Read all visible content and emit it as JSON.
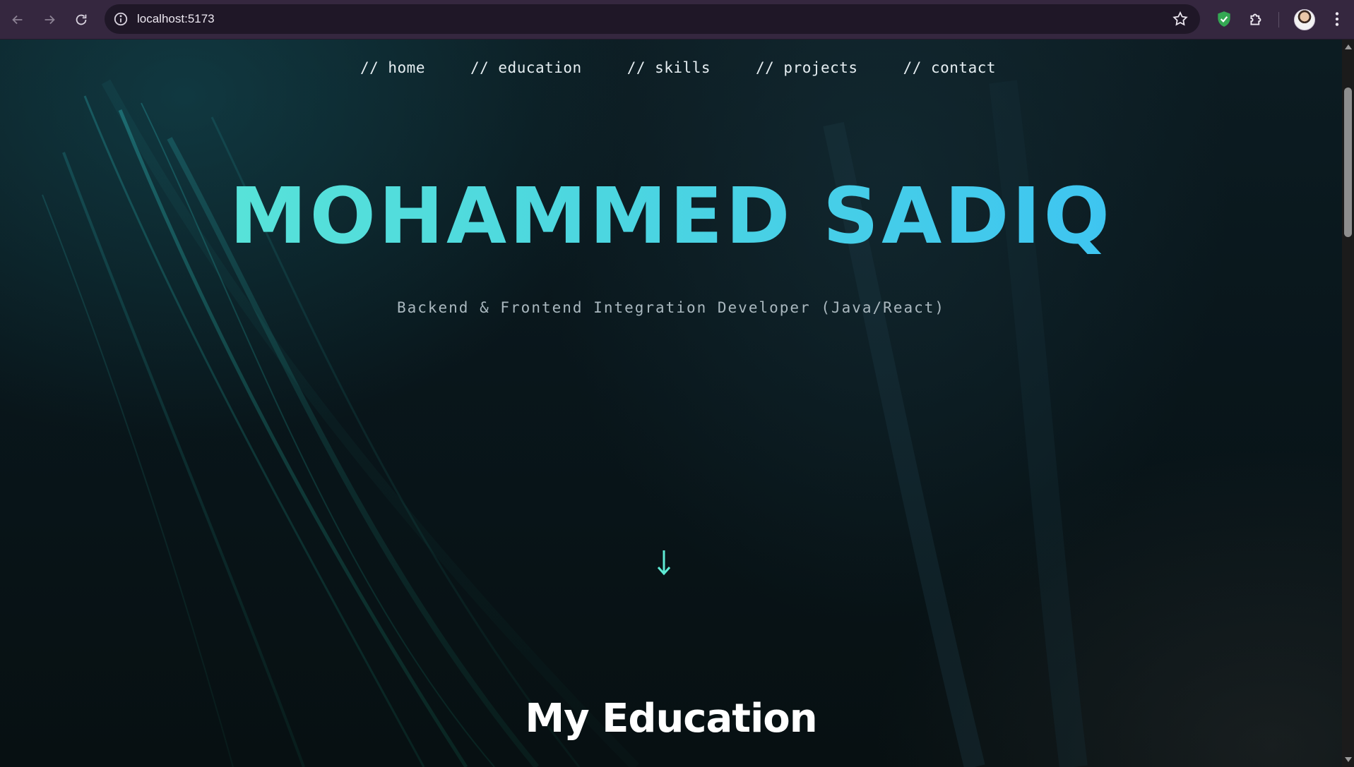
{
  "browser": {
    "url": "localhost:5173",
    "icons": [
      "back-arrow-icon",
      "forward-arrow-icon",
      "reload-icon",
      "site-info-icon",
      "star-icon",
      "shield-extension-icon",
      "puzzle-extension-icon",
      "avatar",
      "more-menu-icon"
    ]
  },
  "site": {
    "nav": [
      {
        "label": "// home"
      },
      {
        "label": "// education"
      },
      {
        "label": "// skills"
      },
      {
        "label": "// projects"
      },
      {
        "label": "// contact"
      }
    ],
    "hero": {
      "name": "MOHAMMED SADIQ",
      "subtitle": "Backend & Frontend Integration Developer (Java/React)",
      "arrow": "↓"
    },
    "next_section_title": "My Education"
  },
  "colors": {
    "accent_start": "#5eead4",
    "accent_end": "#38bdf8",
    "background": "#0b1418"
  }
}
